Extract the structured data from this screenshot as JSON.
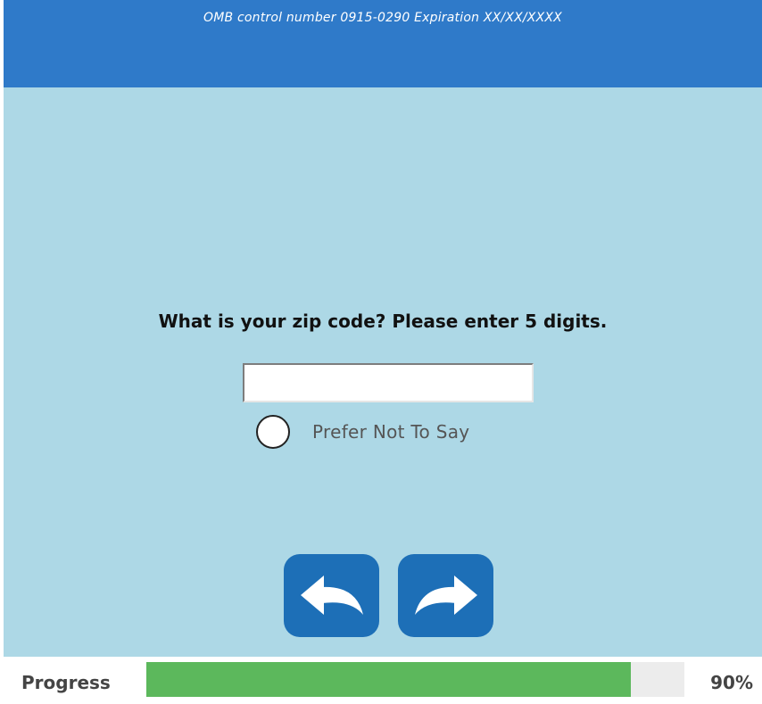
{
  "header": {
    "omb_text": "OMB control number 0915-0290 Expiration XX/XX/XXXX",
    "color": "#2f7ac9"
  },
  "main": {
    "background": "#add8e6",
    "question": "What is your zip code?  Please enter 5 digits.",
    "zip_input": {
      "value": "",
      "placeholder": ""
    },
    "prefer_not_option": {
      "label": "Prefer Not To Say",
      "selected": false
    }
  },
  "navigation": {
    "back_icon": "back-arrow-icon",
    "next_icon": "forward-arrow-icon",
    "button_color": "#1d6fb7"
  },
  "progress": {
    "label": "Progress",
    "percent_text": "90%",
    "value": 0.9,
    "fill_color": "#5cb85c"
  }
}
